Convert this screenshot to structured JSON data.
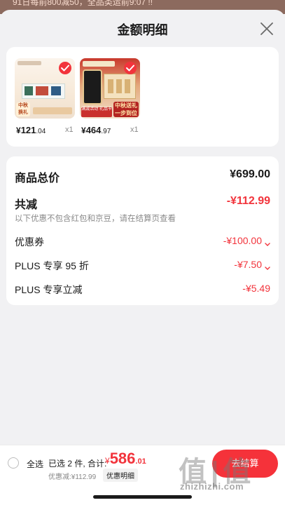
{
  "backdrop": {
    "text": "91日每前800减50，全品类运前9:07 !!",
    "color": "#8c6a5e"
  },
  "sheet": {
    "title": "金额明细"
  },
  "products": [
    {
      "price_symbol": "¥",
      "price_int": "121",
      "price_dec": ".04",
      "qty": "x1",
      "thumb_tag": "中秋换礼",
      "thumb_brand": "朗 Inner 豪华礼盒"
    },
    {
      "price_symbol": "¥",
      "price_int": "464",
      "price_dec": ".97",
      "qty": "x1",
      "thumb_tag": "中秋送礼 一步到位",
      "thumb_brand": "满减活动 礼品卡"
    }
  ],
  "price_summary": {
    "total_label": "商品总价",
    "total_value": "¥699.00",
    "reduce_label": "共减",
    "reduce_value": "-¥112.99",
    "reduce_note": "以下优惠不包含红包和京豆，请在结算页查看",
    "items": [
      {
        "label": "优惠券",
        "value": "-¥100.00",
        "chevron": "chevron-down-icon"
      },
      {
        "label": "PLUS 专享 95 折",
        "value": "-¥7.50",
        "chevron": "chevron-down-icon"
      },
      {
        "label": "PLUS 专享立减",
        "value": "-¥5.49",
        "chevron": ""
      }
    ]
  },
  "bottom_bar": {
    "select_all": "全选",
    "summary": "已选 2 件, 合计:",
    "total_symbol": "¥",
    "total_int": "586",
    "total_dec": ".01",
    "discount_line": "优惠减:¥112.99",
    "detail_button": "优惠明细",
    "checkout_button": "去结算"
  },
  "watermark": {
    "logo": "值|值",
    "url": "zhizhizhi.com"
  },
  "colors": {
    "accent": "#f2343c",
    "card": "#ffffff",
    "sheet": "#f1f1f3"
  }
}
